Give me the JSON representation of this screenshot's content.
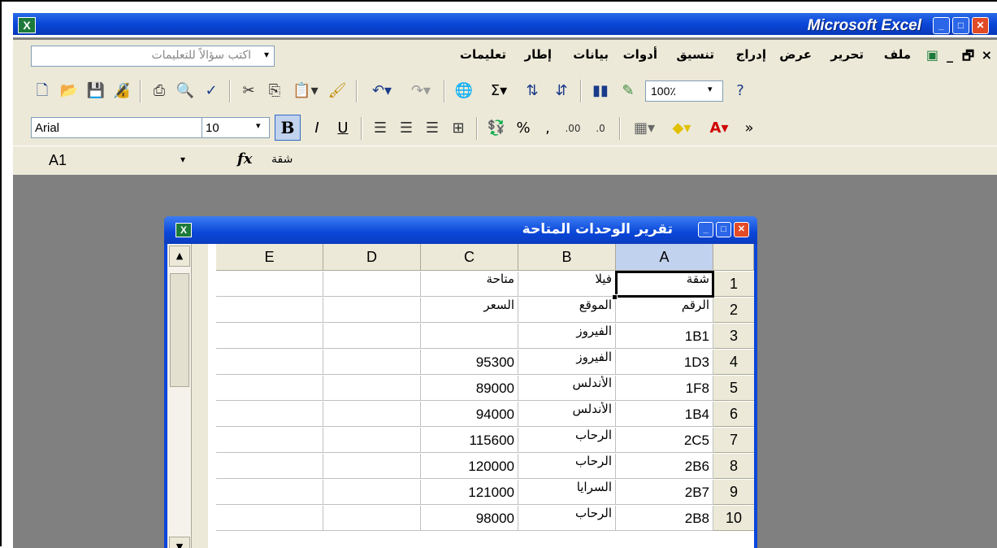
{
  "app": {
    "title": "Microsoft Excel",
    "icon": "excel-icon"
  },
  "menu": {
    "items": [
      "ملف",
      "تحرير",
      "عرض",
      "إدراج",
      "تنسيق",
      "أدوات",
      "بيانات",
      "إطار",
      "تعليمات"
    ],
    "ask_placeholder": "اكتب سؤالاً للتعليمات"
  },
  "toolbar": {
    "zoom": "100٪"
  },
  "format": {
    "font": "Arial",
    "size": "10",
    "bold": "B"
  },
  "formula": {
    "namebox": "A1",
    "fx": "fx",
    "value": "شقة"
  },
  "sheet": {
    "title": "تقرير الوحدات المتاحة",
    "columns": [
      "A",
      "B",
      "C",
      "D",
      "E"
    ],
    "rows": [
      {
        "n": "1",
        "A": "شقة",
        "B": "فيلا",
        "C": "متاحة"
      },
      {
        "n": "2",
        "A": "الرقم",
        "B": "الموقع",
        "C": "السعر"
      },
      {
        "n": "3",
        "A": "1B1",
        "B": "الفيروز",
        "C": ""
      },
      {
        "n": "4",
        "A": "1D3",
        "B": "الفيروز",
        "C": "95300"
      },
      {
        "n": "5",
        "A": "1F8",
        "B": "الأندلس",
        "C": "89000"
      },
      {
        "n": "6",
        "A": "1B4",
        "B": "الأندلس",
        "C": "94000"
      },
      {
        "n": "7",
        "A": "2C5",
        "B": "الرحاب",
        "C": "115600"
      },
      {
        "n": "8",
        "A": "2B6",
        "B": "الرحاب",
        "C": "120000"
      },
      {
        "n": "9",
        "A": "2B7",
        "B": "السرايا",
        "C": "121000"
      },
      {
        "n": "10",
        "A": "2B8",
        "B": "الرحاب",
        "C": "98000"
      }
    ]
  }
}
